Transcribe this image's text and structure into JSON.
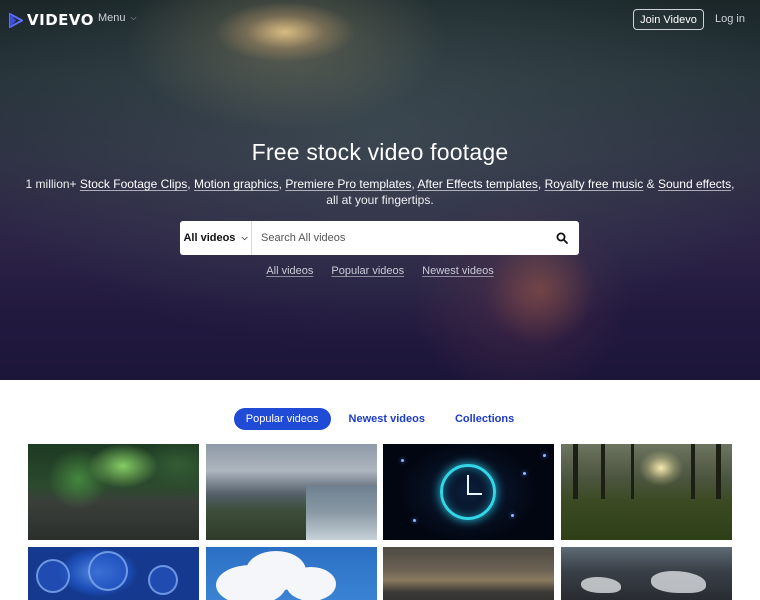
{
  "brand": {
    "name": "VIDEVO",
    "accent": "#1f4bd6"
  },
  "nav": {
    "menu_label": "Menu",
    "join_label": "Join Videvo",
    "login_label": "Log in"
  },
  "hero": {
    "title": "Free stock video footage",
    "subtitle_prefix": "1 million+ ",
    "links": [
      "Stock Footage Clips",
      "Motion graphics",
      "Premiere Pro templates",
      "After Effects templates",
      "Royalty free music",
      "Sound effects"
    ],
    "separators": [
      ", ",
      ", ",
      ", ",
      ", ",
      " & ",
      ", "
    ],
    "subtitle_suffix": "all at your fingertips."
  },
  "search": {
    "type_label": "All videos",
    "placeholder": "Search All videos"
  },
  "quick_links": [
    "All videos",
    "Popular videos",
    "Newest videos"
  ],
  "tabs": [
    {
      "label": "Popular videos",
      "active": true
    },
    {
      "label": "Newest videos",
      "active": false
    },
    {
      "label": "Collections",
      "active": false
    }
  ]
}
